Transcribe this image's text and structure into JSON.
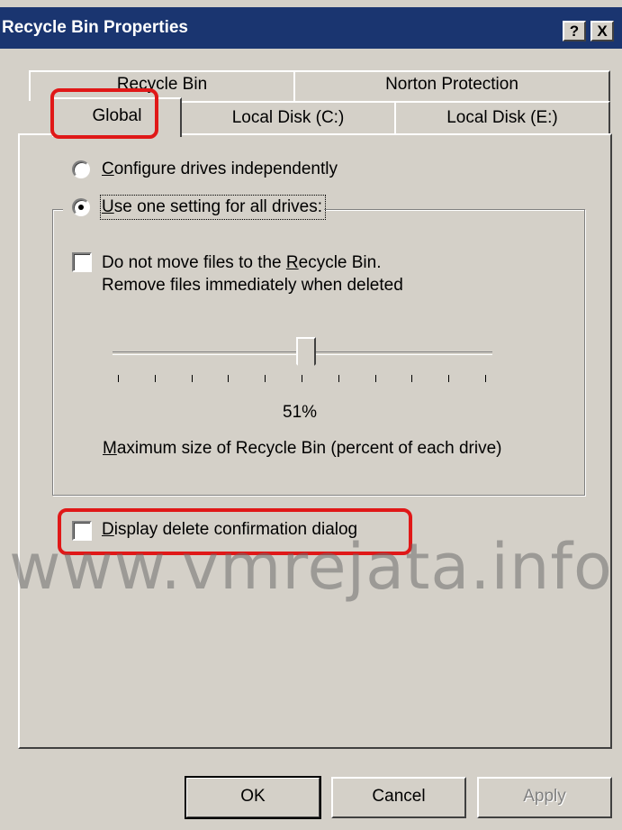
{
  "window": {
    "title": "Recycle Bin Properties",
    "help_label": "?",
    "close_label": "X"
  },
  "tabs": {
    "row1": [
      "Recycle Bin",
      "Norton Protection"
    ],
    "row2": [
      "Global",
      "Local Disk (C:)",
      "Local Disk (E:)"
    ],
    "selected": "Global"
  },
  "options": {
    "configure_independently": {
      "label_accel": "C",
      "label_rest": "onfigure drives independently",
      "selected": false
    },
    "use_one_setting": {
      "label_accel": "U",
      "label_rest": "se one setting for all drives:",
      "selected": true
    },
    "do_not_move": {
      "line1_pre": "Do not move files to the ",
      "line1_accel": "R",
      "line1_post": "ecycle Bin.",
      "line2": "Remove files immediately when deleted",
      "checked": false
    },
    "display_confirmation": {
      "label_accel": "D",
      "label_rest": "isplay delete confirmation dialog",
      "checked": false
    }
  },
  "slider": {
    "value_label": "51%",
    "value_fraction": 0.51,
    "caption_accel": "M",
    "caption_rest": "aximum size of Recycle Bin (percent of each drive)"
  },
  "buttons": {
    "ok": "OK",
    "cancel": "Cancel",
    "apply": "Apply"
  },
  "watermark": "www.vmrejata.info",
  "colors": {
    "titlebar": "#1a3570",
    "highlight": "#e01818",
    "face": "#d4d0c8"
  }
}
